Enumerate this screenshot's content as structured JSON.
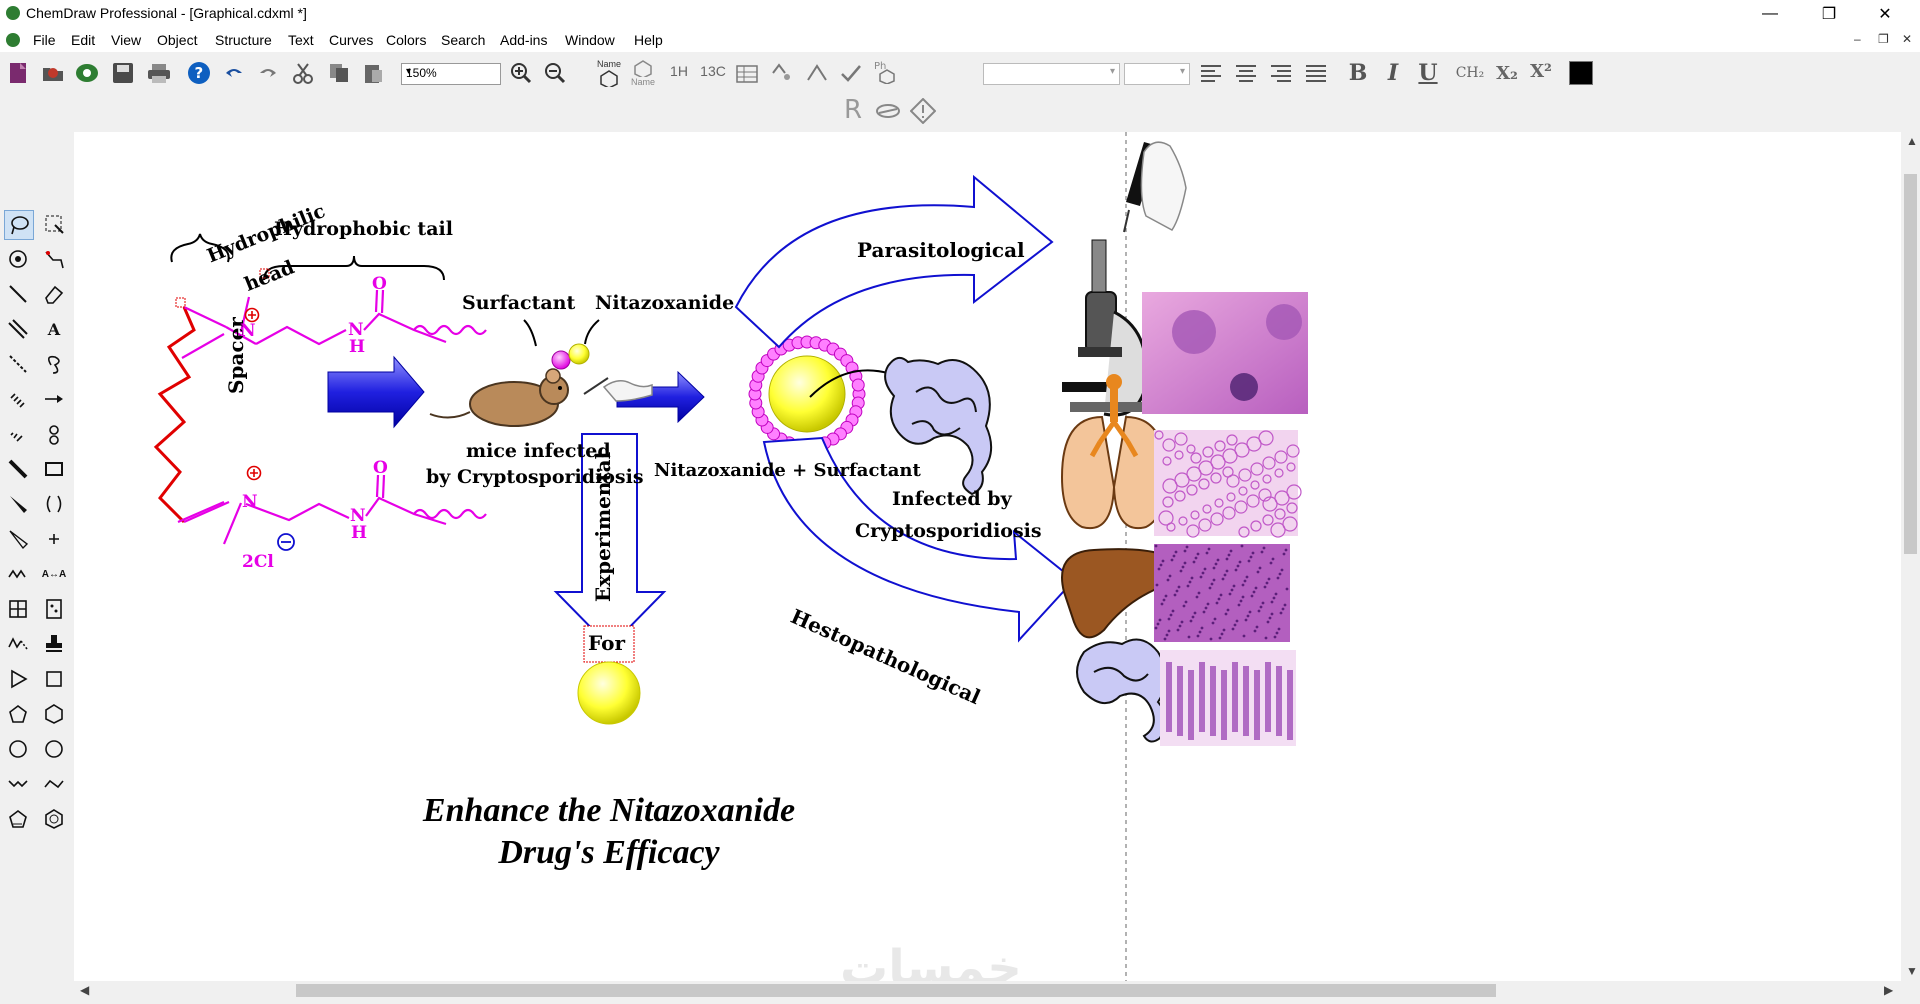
{
  "window": {
    "title": "ChemDraw Professional - [Graphical.cdxml *]",
    "controls": {
      "minimize": "—",
      "maximize": "❐",
      "close": "✕",
      "mdi_minimize": "–",
      "mdi_restore": "❐",
      "mdi_close": "✕"
    }
  },
  "menu": [
    "File",
    "Edit",
    "View",
    "Object",
    "Structure",
    "Text",
    "Curves",
    "Colors",
    "Search",
    "Add-ins",
    "Window",
    "Help"
  ],
  "toolbar": {
    "zoom_value": "150%",
    "name_label": "Name",
    "struct_label": "Name",
    "nmr_1h": "1H",
    "nmr_13c": "13C",
    "text_bold": "B",
    "text_italic": "I",
    "text_underline": "U",
    "text_ch2": "CH₂",
    "text_subscript": "X₂",
    "text_superscript": "X²",
    "r_group": "R"
  },
  "palette": [
    "lasso",
    "marquee",
    "rotate",
    "bond-chain",
    "single-bond",
    "eraser",
    "double-bond",
    "text-A",
    "dashed-bond",
    "orbital",
    "hashed-bond",
    "arrow",
    "hashed-wedge",
    "mass-fragment",
    "bold-bond",
    "rectangle",
    "wedge-bond",
    "brackets",
    "hollow-wedge",
    "plus-charge",
    "chain",
    "atom-map",
    "table",
    "tlc-plate",
    "acyclic-chain",
    "stamp",
    "triangle",
    "square",
    "pentagon",
    "hexagon",
    "cyclohexane",
    "cycloheptane",
    "chair-1",
    "chair-2",
    "cyclopentadiene",
    "benzene"
  ],
  "drawing": {
    "hydrophilic_line1": "Hydrophilic",
    "hydrophilic_line2": "head",
    "hydrophobic_tail": "Hydrophobic tail",
    "spacer": "Spacer",
    "counter_ion": "2Cl",
    "atom_n": "N",
    "atom_o": "O",
    "atom_h": "H",
    "surfactant": "Surfactant",
    "nitazoxanide": "Nitazoxanide",
    "mice_line1": "mice infected",
    "mice_line2": "by Cryptosporidiosis",
    "combo": "Nitazoxanide + Surfactant",
    "infected_line1": "Infected by",
    "infected_line2": "Cryptosporidiosis",
    "parasitological": "Parasitological",
    "hestopathological": "Hestopathological",
    "experimental": "Experimental",
    "for": "For",
    "headline_line1": "Enhance the Nitazoxanide",
    "headline_line2": "Drug's Efficacy"
  },
  "watermark": "خمسات",
  "colors": {
    "magenta": "#e600e6",
    "red_bond": "#e00000",
    "arrow_blue": "#1010d0",
    "sphere_yellow": "#ffff33"
  }
}
